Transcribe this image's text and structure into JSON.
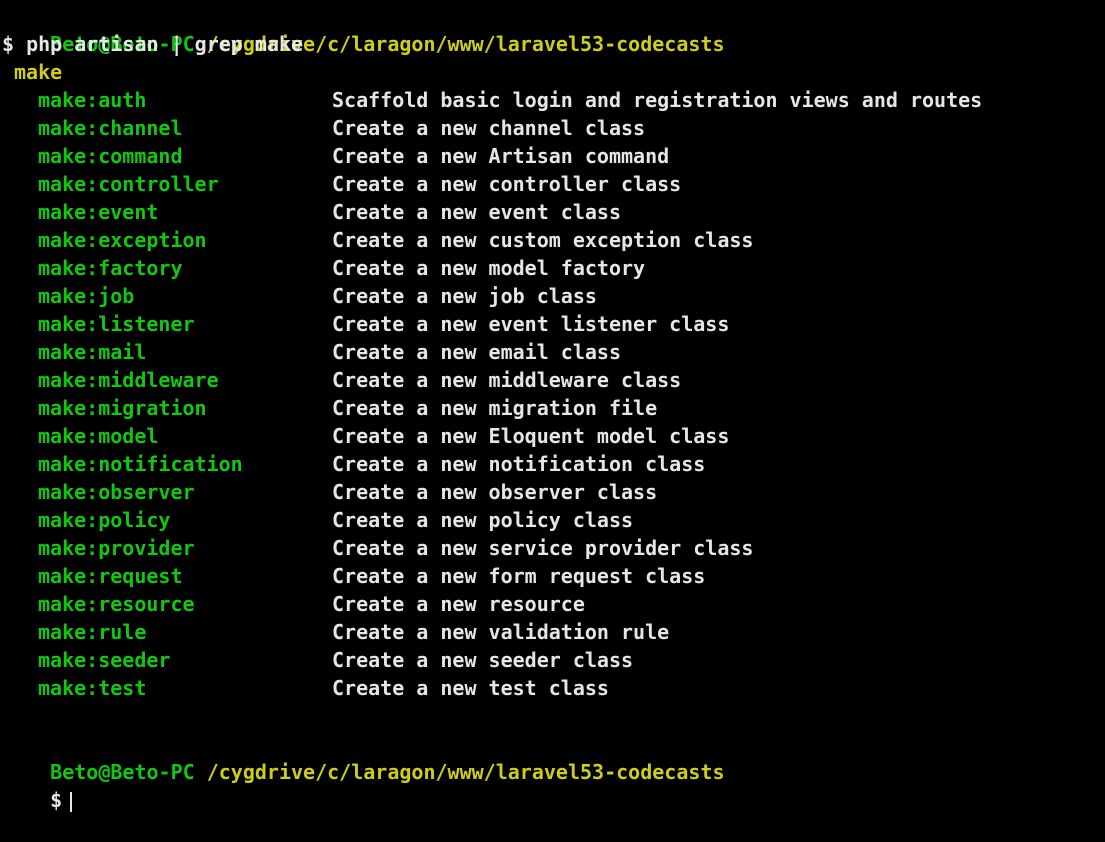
{
  "prompt1": {
    "user": "Beto@Beto-PC",
    "path": "/cygdrive/c/laragon/www/laravel53-codecasts"
  },
  "command_line": "$ php artisan | grep make",
  "group_label": "make",
  "commands": [
    {
      "name": "make:auth",
      "desc": "Scaffold basic login and registration views and routes"
    },
    {
      "name": "make:channel",
      "desc": "Create a new channel class"
    },
    {
      "name": "make:command",
      "desc": "Create a new Artisan command"
    },
    {
      "name": "make:controller",
      "desc": "Create a new controller class"
    },
    {
      "name": "make:event",
      "desc": "Create a new event class"
    },
    {
      "name": "make:exception",
      "desc": "Create a new custom exception class"
    },
    {
      "name": "make:factory",
      "desc": "Create a new model factory"
    },
    {
      "name": "make:job",
      "desc": "Create a new job class"
    },
    {
      "name": "make:listener",
      "desc": "Create a new event listener class"
    },
    {
      "name": "make:mail",
      "desc": "Create a new email class"
    },
    {
      "name": "make:middleware",
      "desc": "Create a new middleware class"
    },
    {
      "name": "make:migration",
      "desc": "Create a new migration file"
    },
    {
      "name": "make:model",
      "desc": "Create a new Eloquent model class"
    },
    {
      "name": "make:notification",
      "desc": "Create a new notification class"
    },
    {
      "name": "make:observer",
      "desc": "Create a new observer class"
    },
    {
      "name": "make:policy",
      "desc": "Create a new policy class"
    },
    {
      "name": "make:provider",
      "desc": "Create a new service provider class"
    },
    {
      "name": "make:request",
      "desc": "Create a new form request class"
    },
    {
      "name": "make:resource",
      "desc": "Create a new resource"
    },
    {
      "name": "make:rule",
      "desc": "Create a new validation rule"
    },
    {
      "name": "make:seeder",
      "desc": "Create a new seeder class"
    },
    {
      "name": "make:test",
      "desc": "Create a new test class"
    }
  ],
  "prompt2": {
    "user": "Beto@Beto-PC",
    "path": "/cygdrive/c/laragon/www/laravel53-codecasts"
  },
  "input_prompt": "$",
  "colors": {
    "background": "#000000",
    "user": "#12c712",
    "path": "#cdcd1a",
    "text": "#e6e6e6",
    "command_name": "#12c712"
  }
}
